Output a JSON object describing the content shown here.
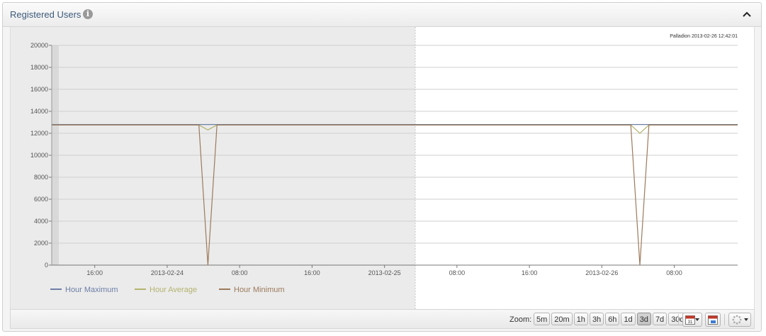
{
  "panel": {
    "title": "Registered Users"
  },
  "chart_data": {
    "type": "line",
    "annotation": "Palladion 2013-02-26 12:42:01",
    "ylim": [
      0,
      20000
    ],
    "y_ticks": [
      0,
      2000,
      4000,
      6000,
      8000,
      10000,
      12000,
      14000,
      16000,
      18000,
      20000
    ],
    "x_tick_labels": [
      "16:00",
      "2013-02-24",
      "08:00",
      "16:00",
      "2013-02-25",
      "08:00",
      "16:00",
      "2013-02-26",
      "08:00"
    ],
    "x_tick_hours": [
      16,
      24,
      32,
      40,
      48,
      56,
      64,
      72,
      80
    ],
    "xlim_hours": [
      11.25,
      87
    ],
    "shaded_until_hours": 51.4,
    "grid": true,
    "legend_position": "bottom-left",
    "series": [
      {
        "name": "Hour Maximum",
        "color": "#6d7fa6",
        "points": [
          [
            11.25,
            12800
          ],
          [
            27.5,
            12800
          ],
          [
            28.5,
            12800
          ],
          [
            29.5,
            12800
          ],
          [
            87,
            12800
          ]
        ]
      },
      {
        "name": "Hour Average",
        "color": "#b3b36f",
        "points": [
          [
            11.25,
            12750
          ],
          [
            27.5,
            12750
          ],
          [
            28.5,
            12300
          ],
          [
            29.5,
            12750
          ],
          [
            51.4,
            12750
          ],
          [
            75.2,
            12750
          ],
          [
            76.2,
            12000
          ],
          [
            77.2,
            12750
          ],
          [
            87,
            12750
          ]
        ]
      },
      {
        "name": "Hour Minimum",
        "color": "#9c7a5c",
        "points": [
          [
            11.25,
            12750
          ],
          [
            27.5,
            12750
          ],
          [
            28.5,
            0
          ],
          [
            29.5,
            12750
          ],
          [
            75.2,
            12750
          ],
          [
            76.2,
            0
          ],
          [
            77.2,
            12750
          ],
          [
            87,
            12750
          ]
        ]
      }
    ]
  },
  "footer": {
    "zoom_label": "Zoom:",
    "zoom_options": [
      "5m",
      "20m",
      "1h",
      "3h",
      "6h",
      "1d",
      "3d",
      "7d",
      "30d"
    ],
    "active_zoom": "3d",
    "calendar_day": "31"
  }
}
